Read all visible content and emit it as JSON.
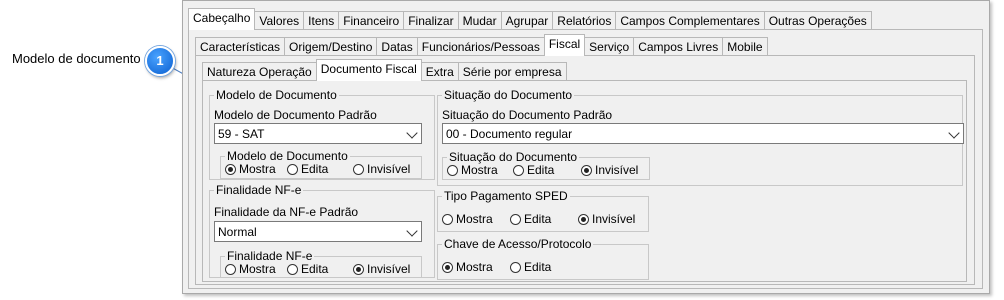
{
  "annotation": {
    "label": "Modelo de documento",
    "badge": "1"
  },
  "tabs_level1": [
    "Cabeçalho",
    "Valores",
    "Itens",
    "Financeiro",
    "Finalizar",
    "Mudar",
    "Agrupar",
    "Relatórios",
    "Campos Complementares",
    "Outras Operações"
  ],
  "tabs_level2": [
    "Características",
    "Origem/Destino",
    "Datas",
    "Funcionários/Pessoas",
    "Fiscal",
    "Serviço",
    "Campos Livres",
    "Mobile"
  ],
  "tabs_level3": [
    "Natureza Operação",
    "Documento Fiscal",
    "Extra",
    "Série por empresa"
  ],
  "modelo": {
    "group_title": "Modelo de Documento",
    "field_label": "Modelo de Documento Padrão",
    "field_value": "59 - SAT",
    "sub_title": "Modelo de Documento",
    "options": [
      "Mostra",
      "Edita",
      "Invisível"
    ],
    "selected": "Mostra"
  },
  "finalidade": {
    "group_title": "Finalidade NF-e",
    "field_label": "Finalidade da NF-e Padrão",
    "field_value": "Normal",
    "sub_title": "Finalidade NF-e",
    "options": [
      "Mostra",
      "Edita",
      "Invisível"
    ],
    "selected": "Invisível"
  },
  "situacao": {
    "group_title": "Situação do Documento",
    "field_label": "Situação do Documento Padrão",
    "field_value": "00 - Documento regular",
    "sub_title": "Situação do Documento",
    "options": [
      "Mostra",
      "Edita",
      "Invisível"
    ],
    "selected": "Invisível"
  },
  "tipo_pagamento": {
    "group_title": "Tipo Pagamento SPED",
    "options": [
      "Mostra",
      "Edita",
      "Invisível"
    ],
    "selected": "Invisível"
  },
  "chave_acesso": {
    "group_title": "Chave de Acesso/Protocolo",
    "options": [
      "Mostra",
      "Edita"
    ],
    "selected": "Mostra"
  }
}
